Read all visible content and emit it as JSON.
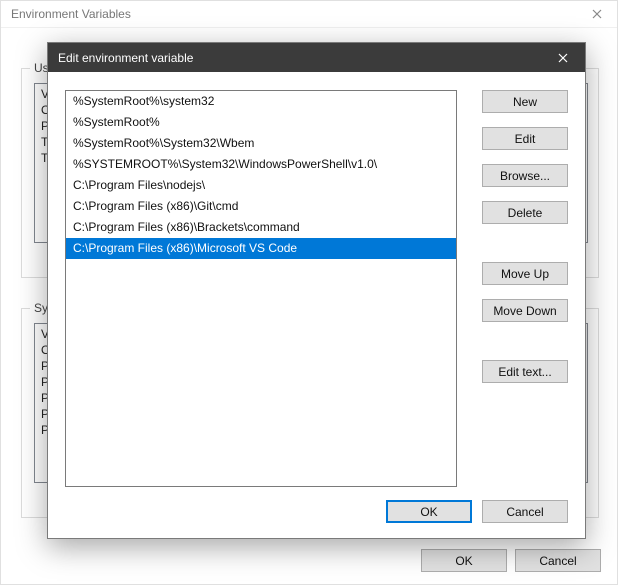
{
  "back": {
    "title": "Environment Variables",
    "user_group_label": "User",
    "sys_group_label": "Syste",
    "user_vars": [
      "Va",
      "Or",
      "Pa",
      "TE",
      "TM"
    ],
    "sys_vars": [
      "Va",
      "OS",
      "Pa",
      "PA",
      "PR",
      "PR",
      "PR"
    ],
    "ok_label": "OK",
    "cancel_label": "Cancel"
  },
  "front": {
    "title": "Edit environment variable",
    "paths": [
      "%SystemRoot%\\system32",
      "%SystemRoot%",
      "%SystemRoot%\\System32\\Wbem",
      "%SYSTEMROOT%\\System32\\WindowsPowerShell\\v1.0\\",
      "C:\\Program Files\\nodejs\\",
      "C:\\Program Files (x86)\\Git\\cmd",
      "C:\\Program Files (x86)\\Brackets\\command",
      "C:\\Program Files (x86)\\Microsoft VS Code"
    ],
    "selected_index": 7,
    "buttons": {
      "new": "New",
      "edit": "Edit",
      "browse": "Browse...",
      "delete": "Delete",
      "moveup": "Move Up",
      "movedown": "Move Down",
      "edittext": "Edit text...",
      "ok": "OK",
      "cancel": "Cancel"
    }
  }
}
